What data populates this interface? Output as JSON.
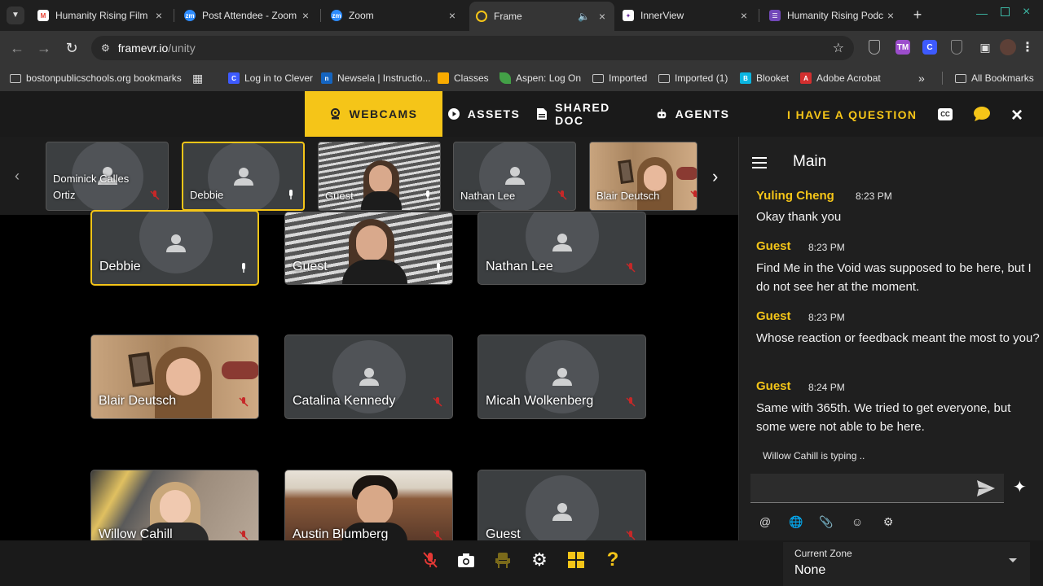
{
  "browser": {
    "tabs": [
      {
        "label": "Humanity Rising Film",
        "icon": "gmail-icon"
      },
      {
        "label": "Post Attendee - Zoom",
        "icon": "zoom-icon"
      },
      {
        "label": "Zoom",
        "icon": "zoom-icon"
      },
      {
        "label": "Frame",
        "icon": "frame-icon"
      },
      {
        "label": "InnerView",
        "icon": "innerview-icon"
      },
      {
        "label": "Humanity Rising Podc",
        "icon": "forms-icon"
      }
    ],
    "url_host": "framevr.io",
    "url_path": "/unity",
    "bookmarks": [
      "bostonpublicschools.org bookmarks",
      "Log in to Clever",
      "Newsela | Instructio...",
      "Classes",
      "Aspen: Log On",
      "Imported",
      "Imported (1)",
      "Blooket",
      "Adobe Acrobat",
      "All Bookmarks"
    ],
    "colors": {
      "accent": "#f5c518"
    }
  },
  "app": {
    "nav": {
      "webcams": "WEBCAMS",
      "assets": "ASSETS",
      "shared_doc": "SHARED DOC",
      "agents": "AGENTS",
      "question": "I HAVE A QUESTION"
    },
    "strip": [
      {
        "name": "Dominick Calles\nOrtiz",
        "mic": "off"
      },
      {
        "name": "Debbie",
        "mic": "on"
      },
      {
        "name": "Guest",
        "mic": "on"
      },
      {
        "name": "Nathan Lee",
        "mic": "off"
      },
      {
        "name": "Blair Deutsch",
        "mic": "off"
      }
    ],
    "grid": [
      {
        "name": "Debbie",
        "mic": "on"
      },
      {
        "name": "Guest",
        "mic": "on"
      },
      {
        "name": "Nathan Lee",
        "mic": "off"
      },
      {
        "name": "Blair Deutsch",
        "mic": "off"
      },
      {
        "name": "Catalina Kennedy",
        "mic": "off"
      },
      {
        "name": "Micah Wolkenberg",
        "mic": "off"
      },
      {
        "name": "Willow Cahill",
        "mic": "off"
      },
      {
        "name": "Austin Blumberg",
        "mic": "off"
      },
      {
        "name": "Guest",
        "mic": "off"
      }
    ],
    "chat": {
      "title": "Main",
      "messages": [
        {
          "user": "Yuling Cheng",
          "time": "8:23 PM",
          "text": "Okay thank you"
        },
        {
          "user": "Guest",
          "time": "8:23 PM",
          "text": "Find Me in the Void was supposed to be here, but I do not see her at the moment."
        },
        {
          "user": "Guest",
          "time": "8:23 PM",
          "text": "Whose reaction or feedback meant the most to you?"
        },
        {
          "user": "Guest",
          "time": "8:24 PM",
          "text": "Same with 365th. We tried to get everyone, but some were not able to be here."
        }
      ],
      "typing": "Willow Cahill is typing .."
    },
    "zone": {
      "label": "Current Zone",
      "value": "None"
    }
  }
}
